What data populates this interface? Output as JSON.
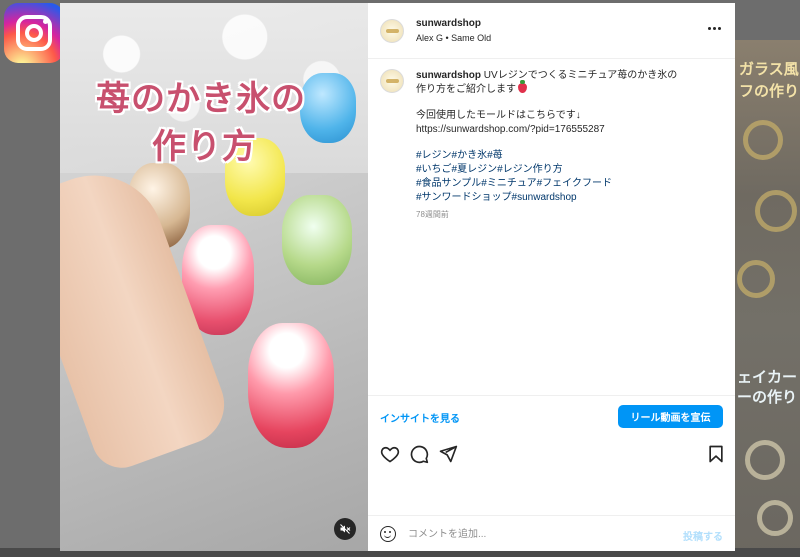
{
  "post": {
    "username": "sunwardshop",
    "subtitle": "Alex G • Same Old",
    "caption_user": "sunwardshop",
    "caption_line1": "UVレジンでつくるミニチュア苺のかき氷の",
    "caption_line2": "作り方をご紹介します",
    "caption_line3": "今回使用したモールドはこちらです↓",
    "caption_link": "https://sunwardshop.com/?pid=176555287",
    "hashtags_1": "#レジン#かき氷#苺",
    "hashtags_2": "#いちご#夏レジン#レジン作り方",
    "hashtags_3": "#食品サンプル#ミニチュア#フェイクフード",
    "hashtags_4": "#サンワードショップ#sunwardshop",
    "time_ago": "78週間前"
  },
  "media": {
    "title_line1": "苺のかき氷の",
    "title_line2": "作り方"
  },
  "actions": {
    "insights_label": "インサイトを見る",
    "promote_label": "リール動画を宣伝"
  },
  "comment": {
    "placeholder": "コメントを追加...",
    "post_label": "投稿する"
  },
  "background": {
    "text1": "ガラス風",
    "text2": "フの作り",
    "text3": "ェイカー",
    "text4": "ーの作り"
  },
  "icons": [
    "instagram-logo",
    "more-options-icon",
    "heart-icon",
    "comment-icon",
    "share-icon",
    "bookmark-icon",
    "emoji-icon",
    "mute-icon"
  ],
  "colors": {
    "accent": "#0095f6",
    "hashtag": "#00376b",
    "title_pink": "#c8506e"
  }
}
